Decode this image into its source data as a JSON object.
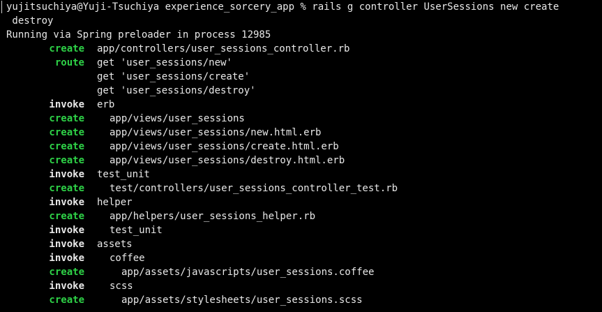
{
  "colors": {
    "background": "#000000",
    "text": "#e8e8e8",
    "create": "#2ed147",
    "route": "#2ed147",
    "invoke": "#e8e8e8"
  },
  "prompt_line": "yujitsuchiya@Yuji-Tsuchiya experience_sorcery_app % rails g controller UserSessions new create",
  "prompt_wrap": " destroy",
  "spring_line": "Running via Spring preloader in process 12985",
  "generator_output": [
    {
      "action": "create",
      "arg": "app/controllers/user_sessions_controller.rb",
      "level": 0
    },
    {
      "action": "route",
      "arg": "get 'user_sessions/new'",
      "level": 0
    },
    {
      "action": "",
      "arg": "get 'user_sessions/create'",
      "level": 0
    },
    {
      "action": "",
      "arg": "get 'user_sessions/destroy'",
      "level": 0
    },
    {
      "action": "invoke",
      "arg": "erb",
      "level": 0
    },
    {
      "action": "create",
      "arg": "app/views/user_sessions",
      "level": 1
    },
    {
      "action": "create",
      "arg": "app/views/user_sessions/new.html.erb",
      "level": 1
    },
    {
      "action": "create",
      "arg": "app/views/user_sessions/create.html.erb",
      "level": 1
    },
    {
      "action": "create",
      "arg": "app/views/user_sessions/destroy.html.erb",
      "level": 1
    },
    {
      "action": "invoke",
      "arg": "test_unit",
      "level": 0
    },
    {
      "action": "create",
      "arg": "test/controllers/user_sessions_controller_test.rb",
      "level": 1
    },
    {
      "action": "invoke",
      "arg": "helper",
      "level": 0
    },
    {
      "action": "create",
      "arg": "app/helpers/user_sessions_helper.rb",
      "level": 1
    },
    {
      "action": "invoke",
      "arg": "test_unit",
      "level": 1
    },
    {
      "action": "invoke",
      "arg": "assets",
      "level": 0
    },
    {
      "action": "invoke",
      "arg": "coffee",
      "level": 1
    },
    {
      "action": "create",
      "arg": "app/assets/javascripts/user_sessions.coffee",
      "level": 2
    },
    {
      "action": "invoke",
      "arg": "scss",
      "level": 1
    },
    {
      "action": "create",
      "arg": "app/assets/stylesheets/user_sessions.scss",
      "level": 2
    }
  ]
}
